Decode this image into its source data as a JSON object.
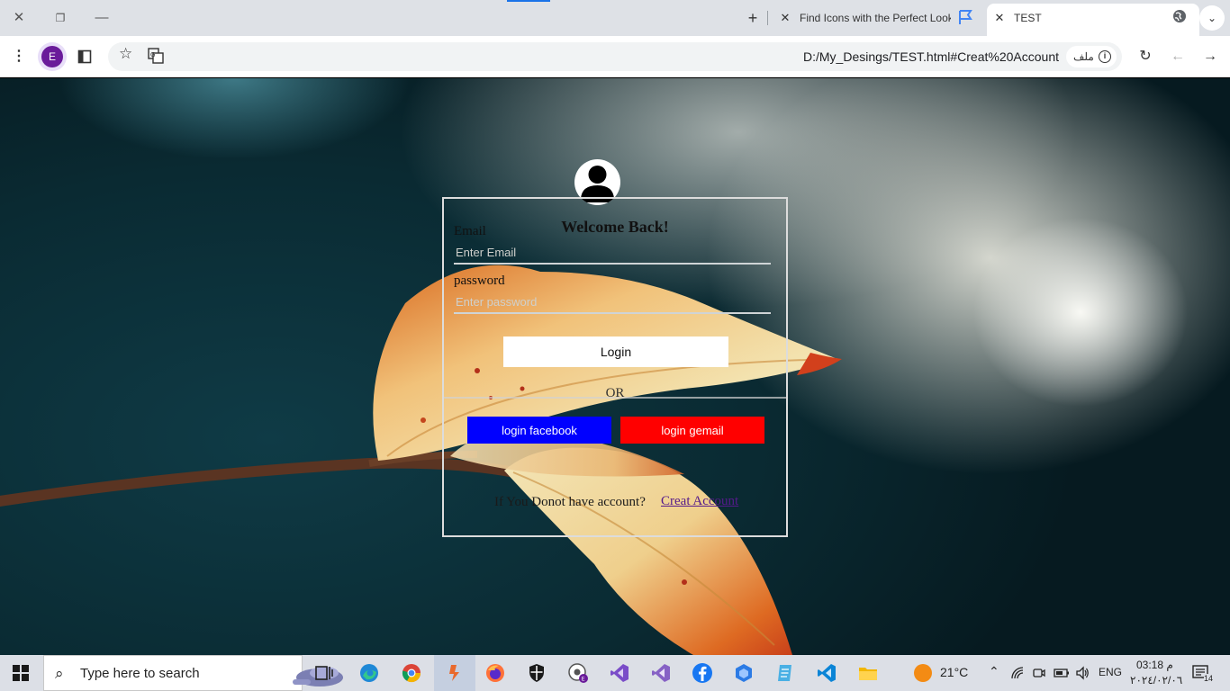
{
  "browser": {
    "tabs": [
      {
        "title": "Find Icons with the Perfect Look",
        "active": false
      },
      {
        "title": "TEST",
        "active": true
      }
    ],
    "address_url": "D:/My_Desings/TEST.html#Creat%20Account",
    "address_chip": "ملف",
    "profile_initial": "E",
    "accent_color": "#1a73e8"
  },
  "form": {
    "heading": "Welcome Back!",
    "email_label": "Email",
    "email_placeholder": "Enter Email",
    "password_label": "password",
    "password_placeholder": "Enter password",
    "login_button": "Login",
    "divider_text": "OR",
    "facebook_button": "login facebook",
    "gmail_button": "login gemail",
    "facebook_color": "#0000ff",
    "gmail_color": "#ff0000",
    "footer_text": "If You Donot have account?",
    "create_link": "Creat Account"
  },
  "taskbar": {
    "search_placeholder": "Type here to search",
    "weather_temp": "21°C",
    "language": "ENG",
    "time": "03:18 م",
    "date": "٢٠٢٤/٠٢/٠٦",
    "notification_count": "14",
    "apps": [
      "task-view",
      "edge",
      "chrome",
      "postman",
      "firefox",
      "security",
      "chrome-profile",
      "visual-studio-preview",
      "visual-studio",
      "facebook",
      "devhome",
      "notepad",
      "vscode",
      "file-explorer"
    ]
  }
}
